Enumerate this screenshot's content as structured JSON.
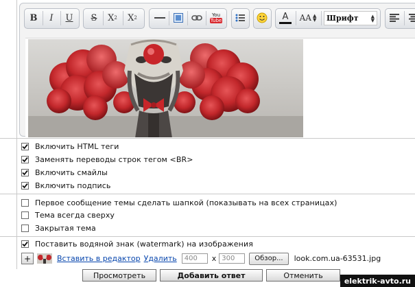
{
  "toolbar": {
    "bold": "B",
    "italic": "I",
    "underline": "U",
    "strike": "S",
    "superscript": "X",
    "superscript_mark": "2",
    "subscript": "X",
    "subscript_mark": "2",
    "youtube_top": "You",
    "youtube_bottom": "Tube",
    "font_color": "A",
    "font_size": "AA",
    "font_select": "Шрифт"
  },
  "options_group1": [
    {
      "label": "Включить HTML теги",
      "checked": true
    },
    {
      "label": "Заменять переводы строк тегом <BR>",
      "checked": true
    },
    {
      "label": "Включить смайлы",
      "checked": true
    },
    {
      "label": "Включить подпись",
      "checked": true
    }
  ],
  "options_group2": [
    {
      "label": "Первое сообщение темы сделать шапкой (показывать на всех страницах)",
      "checked": false
    },
    {
      "label": "Тема всегда сверху",
      "checked": false
    },
    {
      "label": "Закрытая тема",
      "checked": false
    }
  ],
  "watermark_option": {
    "label": "Поставить водяной знак (watermark) на изображения",
    "checked": true
  },
  "attachment": {
    "add_label": "+",
    "insert_link": "Вставить в редактор",
    "delete_link": "Удалить",
    "width_value": "400",
    "times": "x",
    "height_value": "300",
    "browse_label": "Обзор...",
    "filename": "look.com.ua-63531.jpg"
  },
  "actions": {
    "preview": "Просмотреть",
    "submit": "Добавить ответ",
    "cancel": "Отменить"
  },
  "site_watermark": "elektrik-avto.ru",
  "colors": {
    "accent_link": "#0645ad",
    "image_cloud": "#c7282b"
  }
}
